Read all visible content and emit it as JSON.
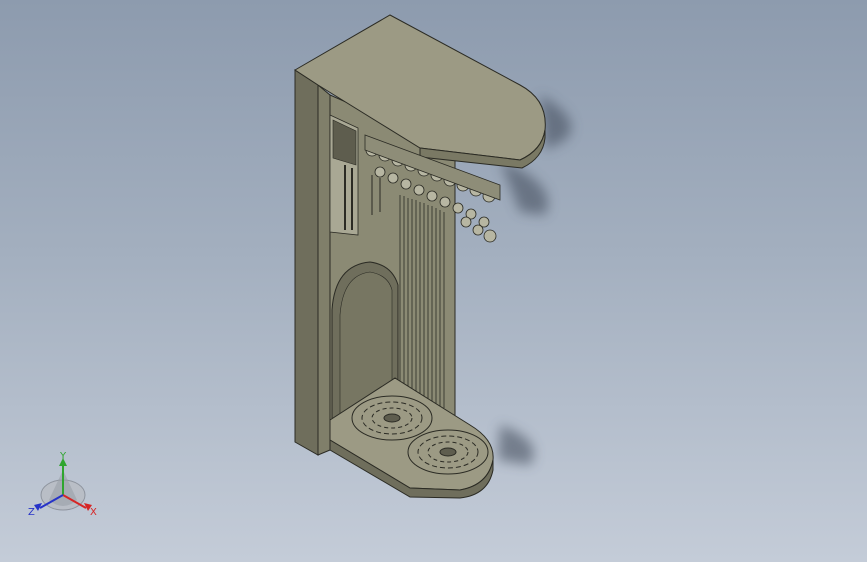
{
  "viewport": {
    "background_top": "#8d9bae",
    "background_bottom": "#c4ccd8"
  },
  "model": {
    "body_color": "#86856f",
    "body_face_light": "#9c9a84",
    "body_face_dark": "#6f6e5c",
    "edge_color": "#2b2b24"
  },
  "triad": {
    "axis_y_label": "Y",
    "axis_x_label": "X",
    "axis_z_label": "Z",
    "y_color": "#2fa52f",
    "x_color": "#d62626",
    "z_color": "#2633c8"
  }
}
